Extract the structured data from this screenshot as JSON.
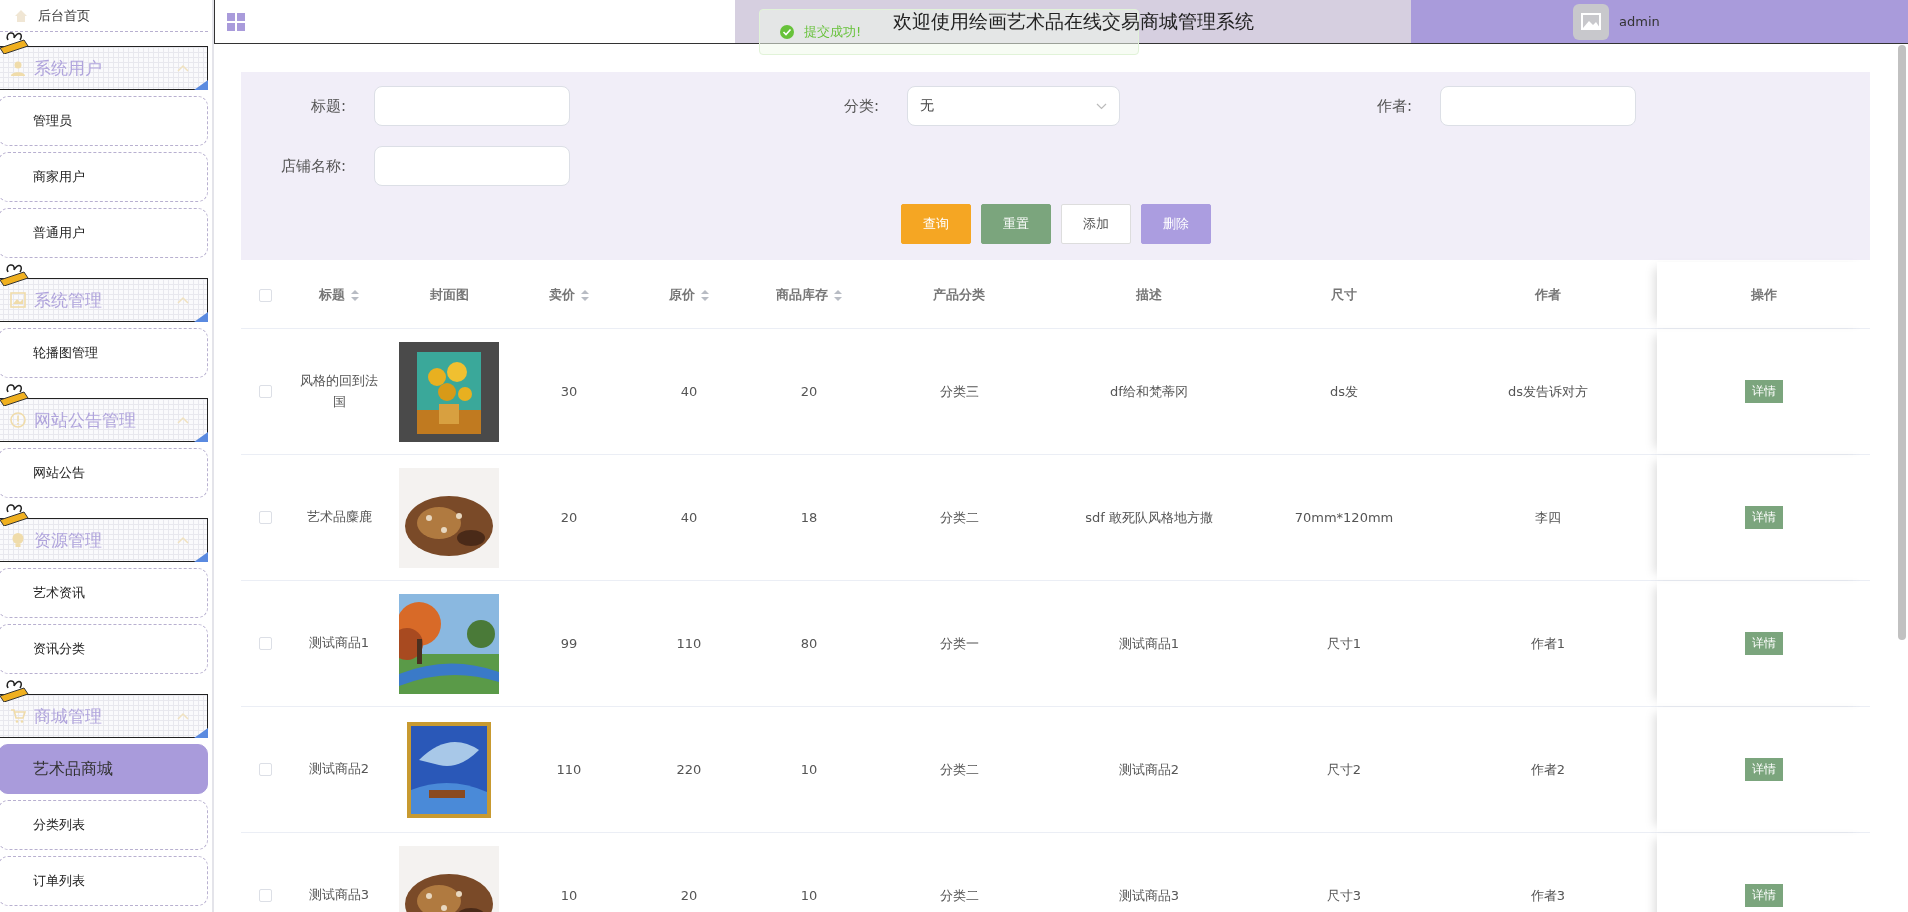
{
  "sidebar": {
    "home": {
      "label": "后台首页"
    },
    "groups": [
      {
        "label": "系统用户",
        "expanded": true,
        "items": [
          {
            "label": "管理员",
            "selected": false
          },
          {
            "label": "商家用户",
            "selected": false
          },
          {
            "label": "普通用户",
            "selected": false
          }
        ]
      },
      {
        "label": "系统管理",
        "expanded": true,
        "items": [
          {
            "label": "轮播图管理",
            "selected": false
          }
        ]
      },
      {
        "label": "网站公告管理",
        "expanded": true,
        "items": [
          {
            "label": "网站公告",
            "selected": false
          }
        ]
      },
      {
        "label": "资源管理",
        "expanded": true,
        "items": [
          {
            "label": "艺术资讯",
            "selected": false
          },
          {
            "label": "资讯分类",
            "selected": false
          }
        ]
      },
      {
        "label": "商城管理",
        "expanded": true,
        "items": [
          {
            "label": "艺术品商城",
            "selected": true
          },
          {
            "label": "分类列表",
            "selected": false
          },
          {
            "label": "订单列表",
            "selected": false
          }
        ]
      }
    ]
  },
  "header": {
    "title": "欢迎使用绘画艺术品在线交易商城管理系统",
    "user": "admin"
  },
  "toast": {
    "message": "提交成功!"
  },
  "filters": {
    "fields": [
      {
        "label": "标题:",
        "kind": "input"
      },
      {
        "label": "分类:",
        "kind": "select",
        "value": "无"
      },
      {
        "label": "作者:",
        "kind": "input"
      },
      {
        "label": "店铺名称:",
        "kind": "input"
      }
    ],
    "buttons": [
      {
        "label": "查询",
        "kind": "warning"
      },
      {
        "label": "重置",
        "kind": "success"
      },
      {
        "label": "添加",
        "kind": "plain"
      },
      {
        "label": "删除",
        "kind": "danger"
      }
    ]
  },
  "table": {
    "header_checked": false,
    "columns": [
      {
        "label": "标题",
        "sortable": true
      },
      {
        "label": "封面图",
        "sortable": false
      },
      {
        "label": "卖价",
        "sortable": true
      },
      {
        "label": "原价",
        "sortable": true
      },
      {
        "label": "商品库存",
        "sortable": true
      },
      {
        "label": "产品分类",
        "sortable": false
      },
      {
        "label": "描述",
        "sortable": false
      },
      {
        "label": "尺寸",
        "sortable": false
      },
      {
        "label": "作者",
        "sortable": false
      },
      {
        "label": "操作",
        "sortable": false
      }
    ],
    "rows": [
      {
        "checked": false,
        "title": "风格的回到法国",
        "price": "30",
        "original_price": "40",
        "stock": "20",
        "category": "分类三",
        "description": "df给和梵蒂冈",
        "size": "ds发",
        "author": "ds发告诉对方",
        "action": "详情"
      },
      {
        "checked": false,
        "title": "艺术品麋鹿",
        "price": "20",
        "original_price": "40",
        "stock": "18",
        "category": "分类二",
        "description": "sdf 敢死队风格地方撒",
        "size": "70mm*120mm",
        "author": "李四",
        "action": "详情"
      },
      {
        "checked": false,
        "title": "测试商品1",
        "price": "99",
        "original_price": "110",
        "stock": "80",
        "category": "分类一",
        "description": "测试商品1",
        "size": "尺寸1",
        "author": "作者1",
        "action": "详情"
      },
      {
        "checked": false,
        "title": "测试商品2",
        "price": "110",
        "original_price": "220",
        "stock": "10",
        "category": "分类二",
        "description": "测试商品2",
        "size": "尺寸2",
        "author": "作者2",
        "action": "详情"
      },
      {
        "checked": false,
        "title": "测试商品3",
        "price": "10",
        "original_price": "20",
        "stock": "10",
        "category": "分类二",
        "description": "测试商品3",
        "size": "尺寸3",
        "author": "作者3",
        "action": "详情"
      }
    ]
  }
}
